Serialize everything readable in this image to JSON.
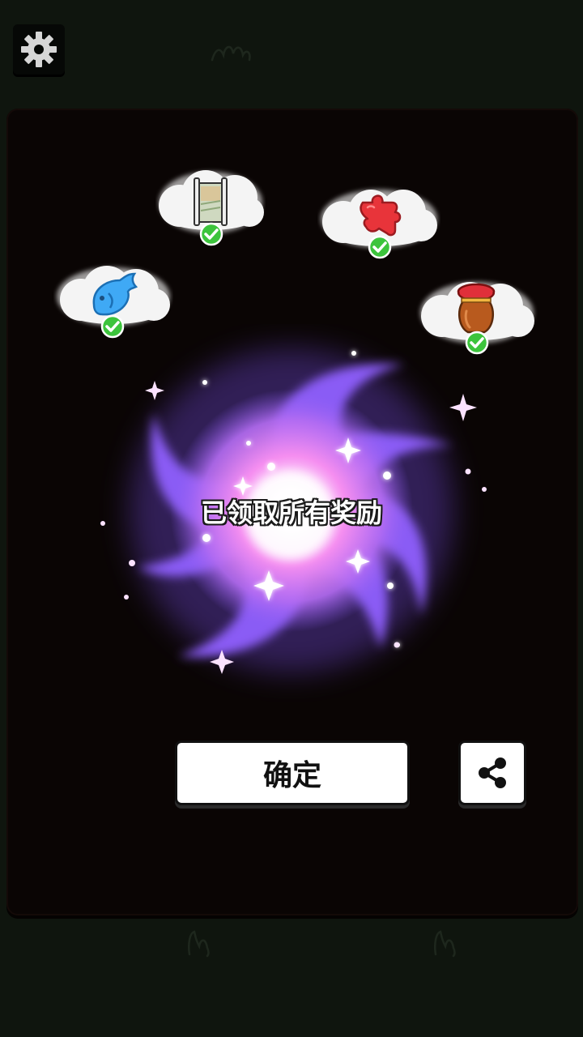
{
  "status": {
    "message": "已领取所有奖励"
  },
  "actions": {
    "confirm_label": "确定"
  },
  "rewards": [
    {
      "item": "fish",
      "claimed": true
    },
    {
      "item": "scroll",
      "claimed": true
    },
    {
      "item": "puzzle-piece",
      "claimed": true
    },
    {
      "item": "jar",
      "claimed": true
    }
  ],
  "icons": {
    "settings": "gear-icon",
    "share": "share-icon",
    "check": "check-icon"
  },
  "colors": {
    "portal_purple": "#8a5cf5",
    "portal_pink": "#f08cf0",
    "check_green": "#3cc43c",
    "panel_bg": "#0a0504",
    "fish_blue": "#3fa9f5",
    "puzzle_red": "#e8343a",
    "jar_brown": "#b85a1e"
  }
}
